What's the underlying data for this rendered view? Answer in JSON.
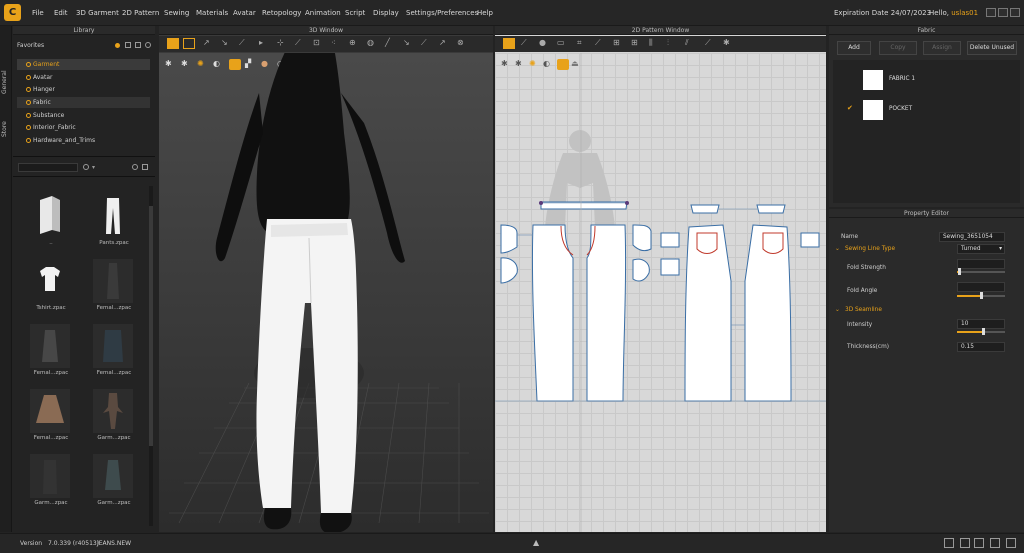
{
  "app": {
    "logo_letter": "C",
    "expiration": "Expiration Date 24/07/2023",
    "greeting": "Hello, ",
    "user": "uslas01"
  },
  "menu": [
    "File",
    "Edit",
    "3D Garment",
    "2D Pattern",
    "Sewing",
    "Materials",
    "Avatar",
    "Retopology",
    "Animation",
    "Script",
    "Display",
    "Settings/Preferences",
    "Help"
  ],
  "side_tabs": [
    "General",
    "Store"
  ],
  "library": {
    "title": "Library",
    "favorites_label": "Favorites",
    "items": [
      "Garment",
      "Avatar",
      "Hanger",
      "Fabric",
      "Substance",
      "Interior_Fabric",
      "Hardware_and_Trims"
    ],
    "selected_index": 0,
    "thumbnails": [
      "..",
      "Pants.zpac",
      "Tshirt.zpac",
      "Femal...zpac",
      "Femal...zpac",
      "Femal...zpac",
      "Femal...zpac",
      "Garm...zpac",
      "Garm...zpac",
      "Garm...zpac"
    ]
  },
  "window3d": {
    "title": "3D Window"
  },
  "window2d": {
    "title": "2D Pattern Window"
  },
  "fabric_panel": {
    "title": "Fabric",
    "buttons": [
      "Add",
      "Copy",
      "Assign",
      "Delete Unused"
    ],
    "items": [
      {
        "name": "FABRIC 1",
        "checked": false
      },
      {
        "name": "POCKET",
        "checked": true
      }
    ]
  },
  "property_editor": {
    "title": "Property Editor",
    "name_label": "Name",
    "name_value": "Sewing_3651054",
    "sewing_line_type_label": "Sewing Line Type",
    "sewing_line_type_value": "Turned",
    "fold_strength_label": "Fold Strength",
    "fold_strength_level": 0.05,
    "fold_angle_label": "Fold Angle",
    "fold_angle_level": 0.5,
    "seamline_label": "3D Seamline",
    "intensity_label": "Intensity",
    "intensity_value": "10",
    "intensity_level": 0.55,
    "thickness_label": "Thickness(cm)",
    "thickness_value": "0.15"
  },
  "status": {
    "version_label": "Version",
    "version_value": "7.0.339 (r40513)",
    "file_name": "JEANS.NEW"
  },
  "colors": {
    "accent": "#e8a21a",
    "pattern_blue": "#3a6ea5",
    "pattern_red": "#c0392b"
  }
}
